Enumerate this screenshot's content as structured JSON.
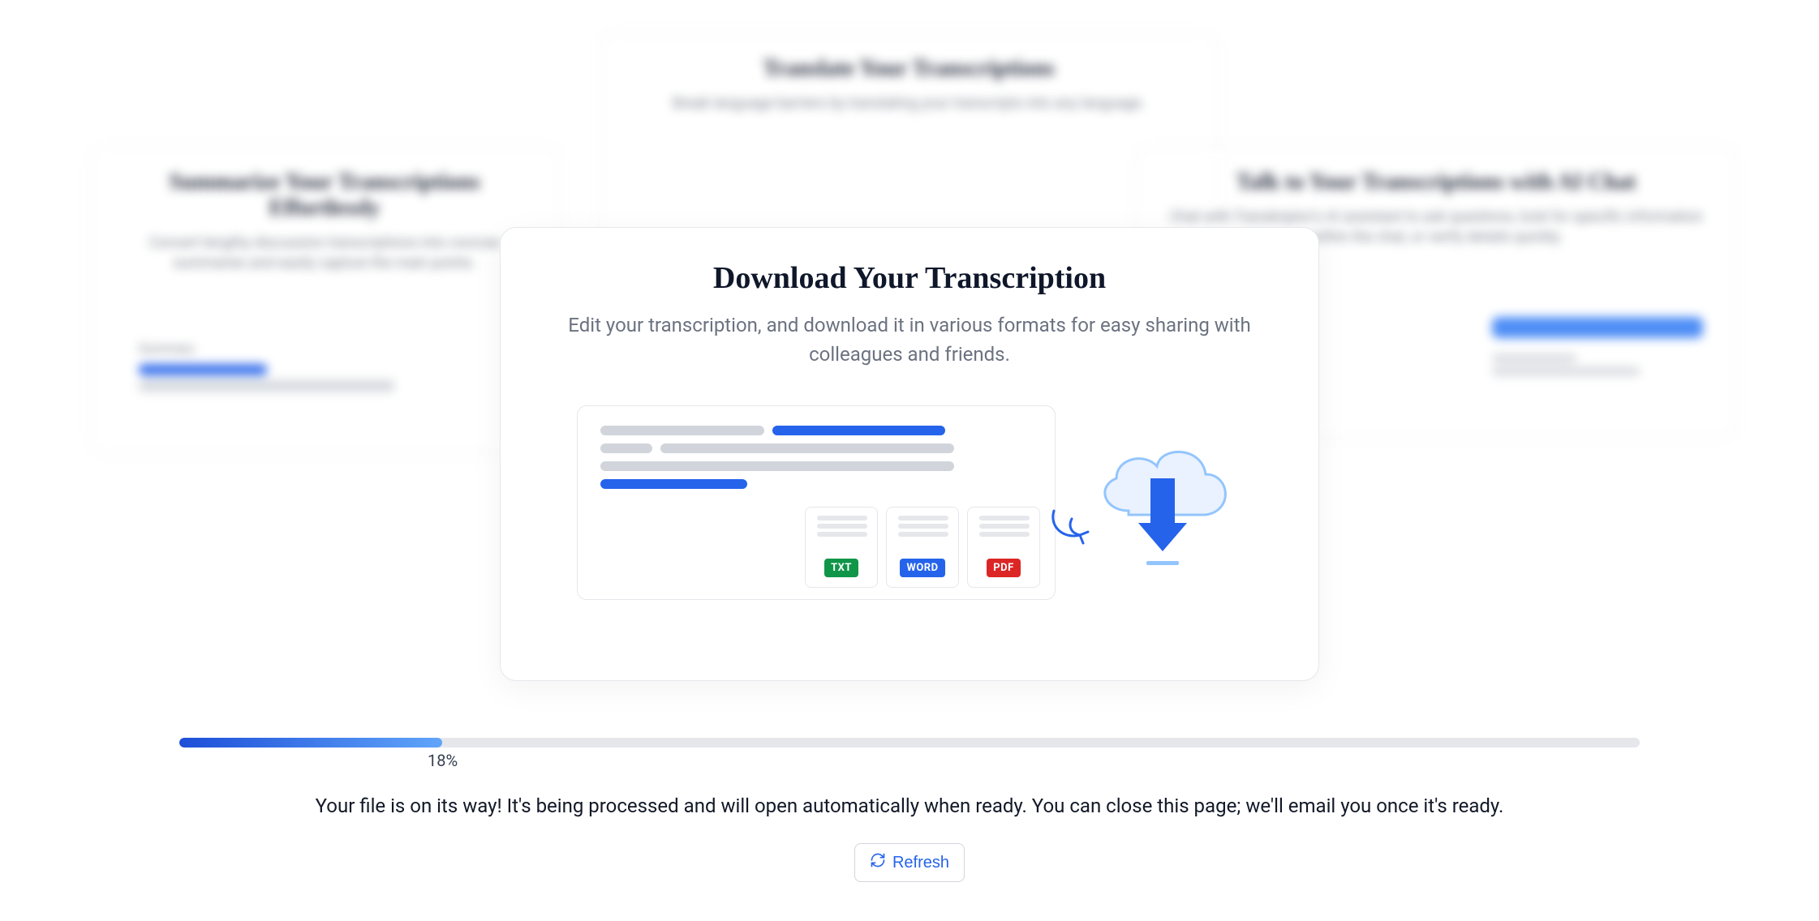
{
  "background": {
    "top_card_title": "Translate Your Transcriptions",
    "top_card_sub": "Break language barriers by translating your transcripts into any language.",
    "left_card_title": "Summarize Your Transcriptions Effortlessly",
    "left_card_sub": "Convert lengthy discussion transcriptions into concise summaries and easily capture the main points.",
    "left_summary_label": "Summary",
    "right_card_title": "Talk to Your Transcriptions with AI Chat",
    "right_card_sub": "Chat with Transkriptor's AI assistant to ask questions, look for specific information within the chat, or verify details quickly."
  },
  "main": {
    "title": "Download Your Transcription",
    "subtitle": "Edit your transcription, and download it in various formats for easy sharing with colleagues and friends.",
    "formats": {
      "txt": "TXT",
      "word": "WORD",
      "pdf": "PDF"
    }
  },
  "progress": {
    "percent": 18,
    "percent_label": "18%"
  },
  "status": "Your file is on its way! It's being processed and will open automatically when ready. You can close this page; we'll email you once it's ready.",
  "refresh_label": "Refresh"
}
